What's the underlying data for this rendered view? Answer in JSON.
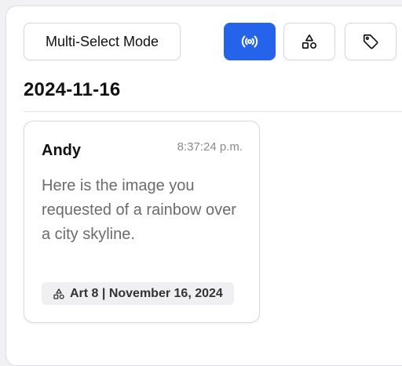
{
  "toolbar": {
    "multi_select_label": "Multi-Select Mode",
    "broadcast_icon": "broadcast-icon",
    "shapes_icon": "shapes-icon",
    "tag_icon": "tag-icon",
    "accent_color": "#2563eb"
  },
  "group": {
    "date": "2024-11-16"
  },
  "message_card": {
    "author": "Andy",
    "time": "8:37:24 p.m.",
    "text": "Here is the image you requested of a rainbow over a city skyline.",
    "tag_icon": "shapes-icon",
    "tag_label": "Art 8 | November 16, 2024"
  }
}
